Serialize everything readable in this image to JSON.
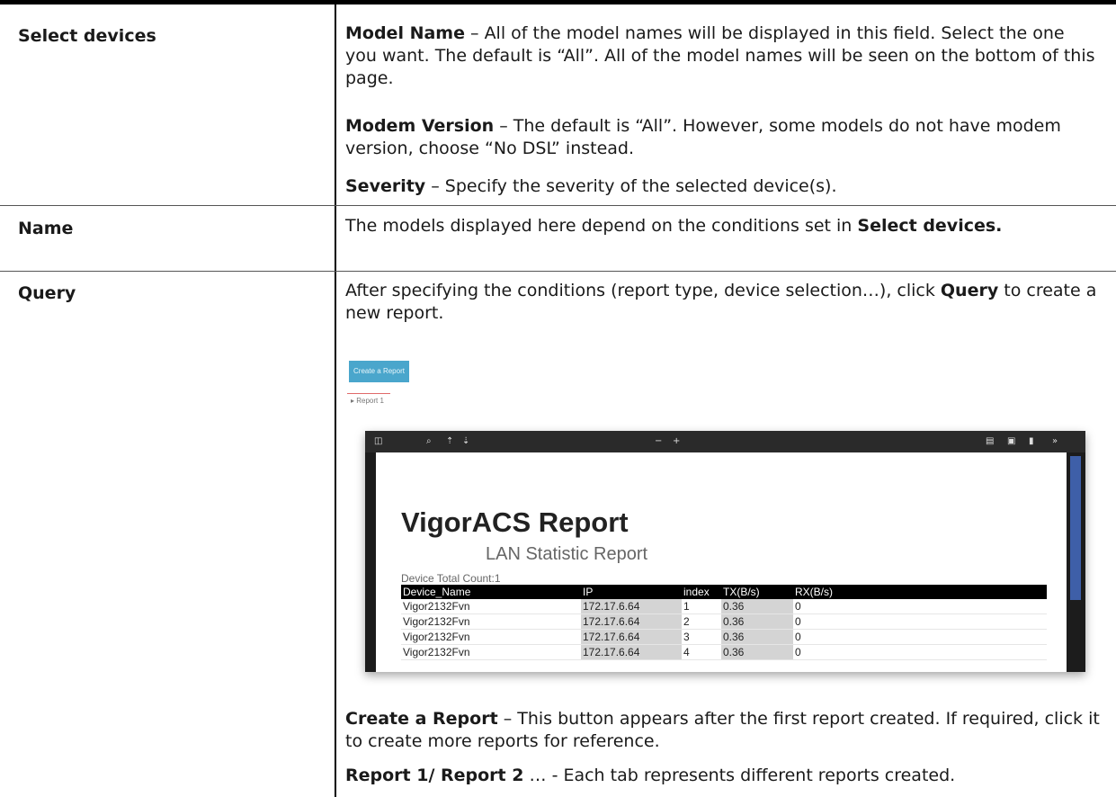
{
  "rows": [
    {
      "label": "Select devices",
      "paragraphs": [
        {
          "term": "Model Name",
          "text": " – All of the model names will be displayed in this field. Select the one you want. The default is “All”. All of the model names will be seen on the bottom of this page."
        },
        {
          "term": "Modem Version",
          "text": " – The default is “All”. However, some models do not have modem version, choose “No DSL” instead."
        },
        {
          "term": "Severity",
          "text": " – Specify the severity of the selected device(s)."
        }
      ]
    },
    {
      "label": "Name",
      "text_before": "The models displayed here depend on the conditions set in ",
      "term": "Select devices."
    },
    {
      "label": "Query",
      "intro_before": "After specifying the conditions (report type, device selection…), click ",
      "intro_term": "Query",
      "intro_after": " to create a new report.",
      "after": [
        {
          "term": "Create a Report",
          "text": " – This button appears after the first report created. If required, click it to create more reports for reference."
        },
        {
          "term": "Report 1/ Report 2",
          "text": " … - Each tab represents different reports created."
        }
      ]
    }
  ],
  "screenshot": {
    "create_button": "Create a Report",
    "tab": "Report 1",
    "report_title": "VigorACS Report",
    "report_subtitle": "LAN Statistic Report",
    "device_count": "Device Total Count:1",
    "columns": [
      "Device_Name",
      "IP",
      "index",
      "TX(B/s)",
      "RX(B/s)"
    ],
    "table_rows": [
      [
        "Vigor2132Fvn",
        "172.17.6.64",
        "1",
        "0.36",
        "0"
      ],
      [
        "Vigor2132Fvn",
        "172.17.6.64",
        "2",
        "0.36",
        "0"
      ],
      [
        "Vigor2132Fvn",
        "172.17.6.64",
        "3",
        "0.36",
        "0"
      ],
      [
        "Vigor2132Fvn",
        "172.17.6.64",
        "4",
        "0.36",
        "0"
      ]
    ]
  }
}
